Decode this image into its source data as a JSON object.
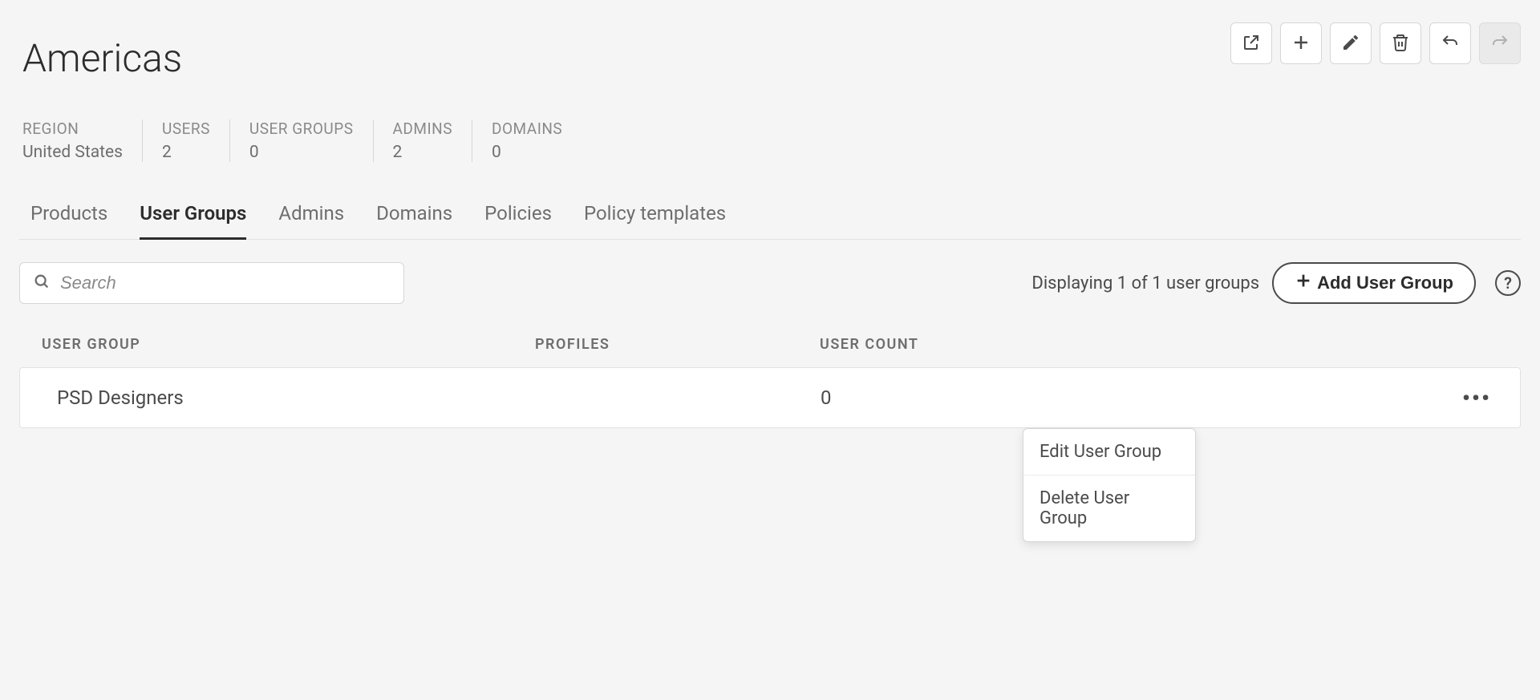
{
  "page": {
    "title": "Americas"
  },
  "stats": {
    "region": {
      "label": "REGION",
      "value": "United States"
    },
    "users": {
      "label": "USERS",
      "value": "2"
    },
    "user_groups": {
      "label": "USER GROUPS",
      "value": "0"
    },
    "admins": {
      "label": "ADMINS",
      "value": "2"
    },
    "domains": {
      "label": "DOMAINS",
      "value": "0"
    }
  },
  "tabs": {
    "products": "Products",
    "user_groups": "User Groups",
    "admins": "Admins",
    "domains": "Domains",
    "policies": "Policies",
    "policy_templates": "Policy templates"
  },
  "search": {
    "placeholder": "Search"
  },
  "listing": {
    "display_text": "Displaying 1 of 1 user groups",
    "add_button": "Add User Group",
    "help_label": "?"
  },
  "table": {
    "headers": {
      "group": "USER GROUP",
      "profiles": "PROFILES",
      "count": "USER COUNT"
    },
    "rows": [
      {
        "name": "PSD Designers",
        "profiles": "",
        "user_count": "0"
      }
    ]
  },
  "context_menu": {
    "edit": "Edit User Group",
    "delete": "Delete User Group"
  }
}
